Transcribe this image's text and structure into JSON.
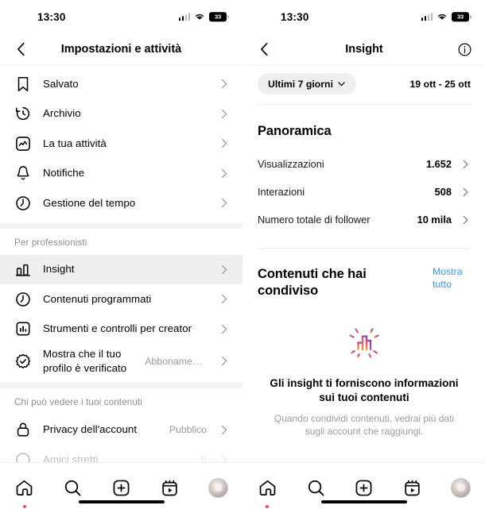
{
  "status_bar": {
    "time": "13:30",
    "battery_level": "33",
    "wifi_icon": "wifi-icon",
    "cellular_icon": "cellular-signal-icon"
  },
  "left_screen": {
    "header": {
      "back_icon": "back-chevron-icon",
      "title": "Impostazioni e attività"
    },
    "groups": [
      {
        "header": null,
        "items": [
          {
            "icon": "bookmark-icon",
            "label": "Salvato",
            "value": null,
            "highlighted": false
          },
          {
            "icon": "archive-clock-icon",
            "label": "Archivio",
            "value": null,
            "highlighted": false
          },
          {
            "icon": "activity-chart-icon",
            "label": "La tua attività",
            "value": null,
            "highlighted": false
          },
          {
            "icon": "bell-icon",
            "label": "Notifiche",
            "value": null,
            "highlighted": false
          },
          {
            "icon": "clock-icon",
            "label": "Gestione del tempo",
            "value": null,
            "highlighted": false
          }
        ]
      },
      {
        "header": "Per professionisti",
        "items": [
          {
            "icon": "insights-bars-icon",
            "label": "Insight",
            "value": null,
            "highlighted": true
          },
          {
            "icon": "clock-icon",
            "label": "Contenuti programmati",
            "value": null,
            "highlighted": false
          },
          {
            "icon": "creator-tools-icon",
            "label": "Strumenti e controlli per creator",
            "value": null,
            "highlighted": false
          },
          {
            "icon": "verified-badge-icon",
            "label": "Mostra che il tuo profilo è verificato",
            "value": "Abbonamento non sotto...",
            "highlighted": false
          }
        ]
      },
      {
        "header": "Chi può vedere i tuoi contenuti",
        "items": [
          {
            "icon": "lock-icon",
            "label": "Privacy dell'account",
            "value": "Pubblico",
            "highlighted": false
          },
          {
            "icon": "circle-icon",
            "label": "Amici stretti",
            "value": "0",
            "highlighted": false
          }
        ]
      }
    ]
  },
  "right_screen": {
    "header": {
      "back_icon": "back-chevron-icon",
      "title": "Insight",
      "info_icon": "info-circle-icon"
    },
    "filter": {
      "chip_label": "Ultimi 7 giorni",
      "chip_icon": "chevron-down-icon",
      "date_range": "19 ott - 25 ott"
    },
    "overview": {
      "title": "Panoramica",
      "stats": [
        {
          "name": "Visualizzazioni",
          "value": "1.652"
        },
        {
          "name": "Interazioni",
          "value": "508"
        },
        {
          "name": "Numero totale di follower",
          "value": "10 mila"
        }
      ]
    },
    "shared_content": {
      "title": "Contenuti che hai condiviso",
      "show_all": "Mostra tutto",
      "empty_icon": "insights-sparkle-chart-icon",
      "empty_title": "Gli insight ti forniscono informazioni sui tuoi contenuti",
      "empty_subtitle": "Quando condividi contenuti, vedrai più dati sugli account che raggiungi."
    }
  },
  "tab_bar": {
    "items": [
      {
        "icon": "home-icon",
        "has_dot": true
      },
      {
        "icon": "search-icon",
        "has_dot": false
      },
      {
        "icon": "create-plus-icon",
        "has_dot": false
      },
      {
        "icon": "reels-icon",
        "has_dot": false
      },
      {
        "icon": "profile-avatar-icon",
        "has_dot": false
      }
    ]
  },
  "colors": {
    "accent_link": "#3897f0",
    "notification_dot": "#ef4b57",
    "highlight_row": "#efefef"
  }
}
